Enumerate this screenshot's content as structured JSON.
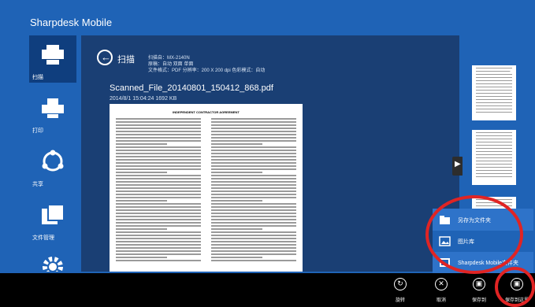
{
  "app": {
    "title": "Sharpdesk Mobile"
  },
  "sidebar": {
    "items": [
      {
        "label": "扫描",
        "icon": "scan-icon"
      },
      {
        "label": "打印",
        "icon": "print-icon"
      },
      {
        "label": "共享",
        "icon": "share-icon"
      },
      {
        "label": "文件管理",
        "icon": "file-manager-icon"
      },
      {
        "label": "",
        "icon": "settings-icon"
      }
    ]
  },
  "main": {
    "heading": "扫描",
    "meta": [
      "扫描自：MX-2140N",
      "原稿：自动 双面 单面",
      "文件格式：PDF  分辨率：200 X 200 dpi  色彩模式：自动"
    ],
    "file": {
      "name": "Scanned_File_20140801_150412_868.pdf",
      "date": "2014/8/1 15:04:24 1692 KB"
    },
    "preview_heading": "INDEPENDENT CONTRACTOR AGREEMENT"
  },
  "popup": {
    "items": [
      {
        "label": "另存为文件夹",
        "icon": "folder-icon"
      },
      {
        "label": "图片库",
        "icon": "picture-library-icon"
      },
      {
        "label": "Sharpdesk Mobile文件夹",
        "icon": "sharpdesk-folder-icon"
      }
    ]
  },
  "appbar": {
    "buttons": [
      {
        "label": "旋转",
        "icon": "rotate-icon"
      },
      {
        "label": "取消",
        "icon": "cancel-icon"
      },
      {
        "label": "保存到",
        "icon": "save-to-icon"
      },
      {
        "label": "保存到这里",
        "icon": "save-here-icon"
      }
    ]
  },
  "colors": {
    "accent": "#1f63b6",
    "panel": "#1a3f74",
    "highlight": "#e02424"
  }
}
